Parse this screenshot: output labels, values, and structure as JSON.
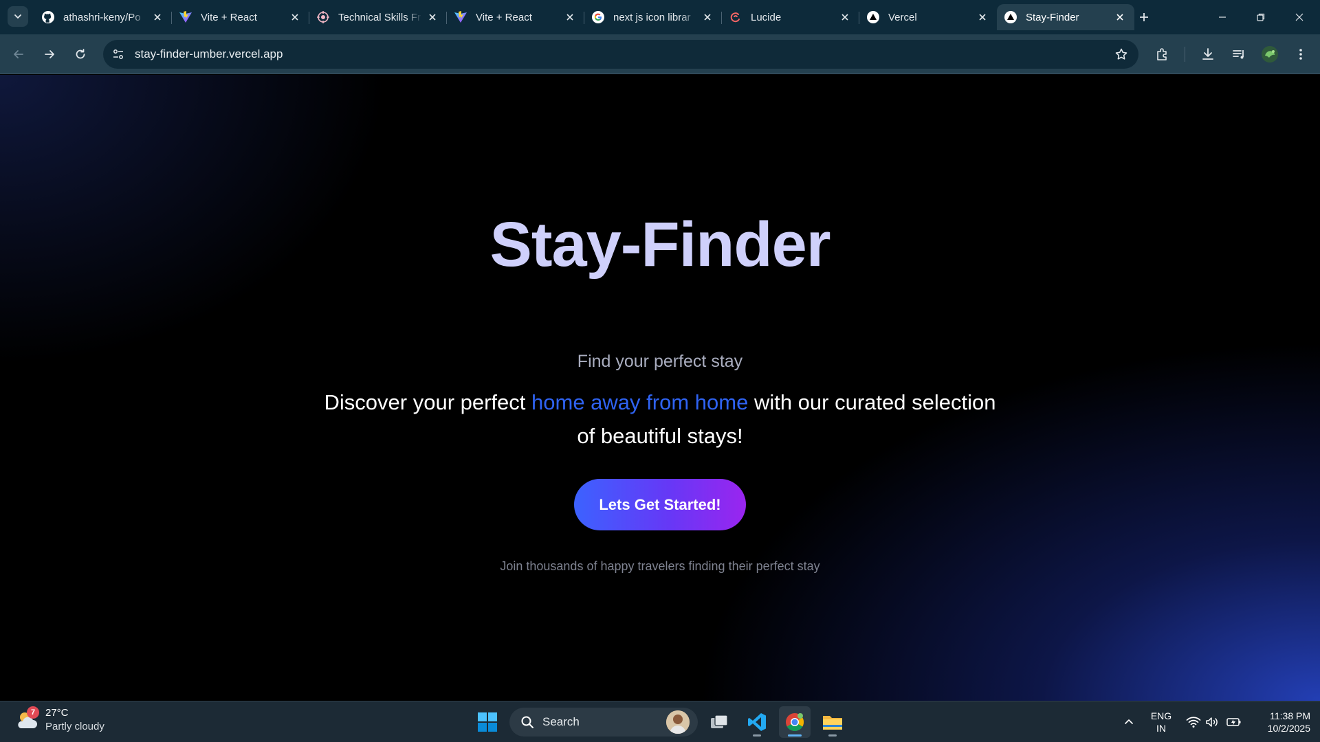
{
  "browser": {
    "tabs": [
      {
        "title": "athashri-keny/Po",
        "icon": "github-icon"
      },
      {
        "title": "Vite + React",
        "icon": "vite-icon"
      },
      {
        "title": "Technical Skills Fr",
        "icon": "skills-icon"
      },
      {
        "title": "Vite + React",
        "icon": "vite-icon"
      },
      {
        "title": "next js icon librar",
        "icon": "google-icon"
      },
      {
        "title": "Lucide",
        "icon": "lucide-icon"
      },
      {
        "title": "Vercel",
        "icon": "vercel-icon"
      },
      {
        "title": "Stay-Finder",
        "icon": "vercel-icon",
        "active": true
      }
    ],
    "address": {
      "url": "stay-finder-umber.vercel.app"
    }
  },
  "page": {
    "title": "Stay-Finder",
    "subtitle": "Find your perfect stay",
    "tagline": {
      "before": "Discover your perfect ",
      "highlight": "home away from home",
      "after": " with our curated selection of beautiful stays!"
    },
    "cta_label": "Lets Get Started!",
    "footnote": "Join thousands of happy travelers finding their perfect stay",
    "colors": {
      "title": "#cfd0fb",
      "highlight": "#2f63f2",
      "cta_start": "#3c62ff",
      "cta_end": "#9a25ef"
    }
  },
  "taskbar": {
    "weather": {
      "temp": "27°C",
      "condition": "Partly cloudy",
      "badge": "7"
    },
    "search_label": "Search",
    "lang": {
      "line1": "ENG",
      "line2": "IN"
    },
    "clock": {
      "time": "11:38 PM",
      "date": "10/2/2025"
    }
  }
}
